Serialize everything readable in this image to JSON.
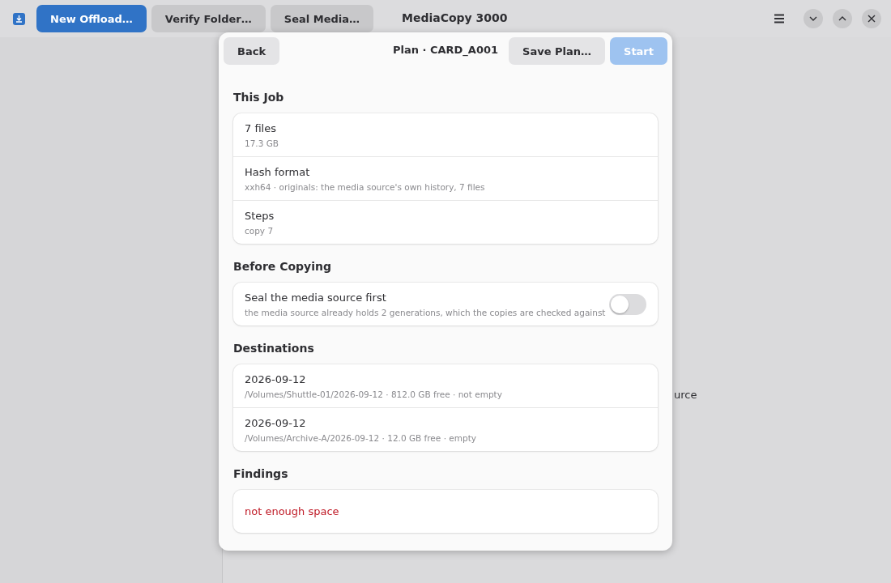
{
  "window": {
    "title": "MediaCopy 3000"
  },
  "header_buttons": [
    {
      "label": "New Offload…",
      "kind": "primary"
    },
    {
      "label": "Verify Folder…",
      "kind": "normal"
    },
    {
      "label": "Seal Media…",
      "kind": "normal"
    }
  ],
  "background_text": "urce",
  "dialog": {
    "title": "Plan · CARD_A001",
    "back": "Back",
    "save": "Save Plan…",
    "start": {
      "label": "Start",
      "disabled": true
    },
    "sections": [
      {
        "heading": "This Job",
        "rows": [
          {
            "title": "7 files",
            "subtitle": "17.3 GB"
          },
          {
            "title": "Hash format",
            "subtitle": "xxh64 · originals: the media source's own history, 7 files"
          },
          {
            "title": "Steps",
            "subtitle": "copy 7"
          }
        ]
      },
      {
        "heading": "Before Copying",
        "rows": [
          {
            "title": "Seal the media source first",
            "subtitle": "the media source already holds 2 generations, which the copies are checked against",
            "kind": "switch",
            "on": false
          }
        ]
      },
      {
        "heading": "Destinations",
        "rows": [
          {
            "title": "2026-09-12",
            "subtitle": "/Volumes/Shuttle-01/2026-09-12 · 812.0 GB free · not empty"
          },
          {
            "title": "2026-09-12",
            "subtitle": "/Volumes/Archive-A/2026-09-12 · 12.0 GB free · empty"
          }
        ]
      },
      {
        "heading": "Findings",
        "rows": [
          {
            "title": "not enough space",
            "kind": "error"
          }
        ]
      }
    ]
  }
}
